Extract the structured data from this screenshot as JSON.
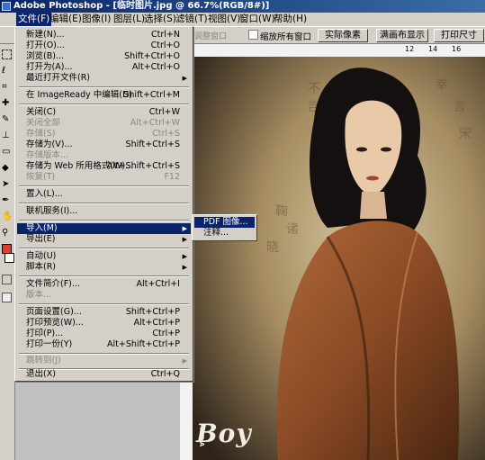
{
  "window": {
    "title": "Adobe Photoshop - [临时图片.jpg @ 66.7%(RGB/8#)]"
  },
  "menubar": {
    "items": [
      "文件(F)",
      "编辑(E)",
      "图像(I)",
      "图层(L)",
      "选择(S)",
      "滤镜(T)",
      "视图(V)",
      "窗口(W)",
      "帮助(H)"
    ]
  },
  "options": {
    "faded_label": "调整窗口",
    "checkbox_label": "缩放所有窗口",
    "actual_pixels": "实际像素",
    "fit_screen": "满画布显示",
    "print_size": "打印尺寸",
    "ruler_top_ticks": [
      "12",
      "14",
      "16"
    ]
  },
  "file_menu": {
    "items": [
      {
        "label": "新建(N)...",
        "shortcut": "Ctrl+N"
      },
      {
        "label": "打开(O)...",
        "shortcut": "Ctrl+O"
      },
      {
        "label": "浏览(B)...",
        "shortcut": "Shift+Ctrl+O"
      },
      {
        "label": "打开为(A)...",
        "shortcut": "Alt+Ctrl+O"
      },
      {
        "label": "最近打开文件(R)",
        "shortcut": "",
        "submenu": true
      },
      {
        "label": "在 ImageReady 中编辑(D)",
        "shortcut": "Shift+Ctrl+M"
      },
      {
        "label": "关闭(C)",
        "shortcut": "Ctrl+W"
      },
      {
        "label": "关闭全部",
        "shortcut": "Alt+Ctrl+W",
        "disabled": true
      },
      {
        "label": "存储(S)",
        "shortcut": "Ctrl+S",
        "disabled": true
      },
      {
        "label": "存储为(V)...",
        "shortcut": "Shift+Ctrl+S"
      },
      {
        "label": "存储版本...",
        "shortcut": "",
        "disabled": true
      },
      {
        "label": "存储为 Web 所用格式(W)...",
        "shortcut": "Alt+Shift+Ctrl+S"
      },
      {
        "label": "恢复(T)",
        "shortcut": "F12",
        "disabled": true
      },
      {
        "label": "置入(L)...",
        "shortcut": ""
      },
      {
        "label": "联机服务(I)...",
        "shortcut": ""
      },
      {
        "label": "导入(M)",
        "shortcut": "",
        "submenu": true,
        "highlighted": true
      },
      {
        "label": "导出(E)",
        "shortcut": "",
        "submenu": true
      },
      {
        "label": "自动(U)",
        "shortcut": "",
        "submenu": true
      },
      {
        "label": "脚本(R)",
        "shortcut": "",
        "submenu": true
      },
      {
        "label": "文件简介(F)...",
        "shortcut": "Alt+Ctrl+I"
      },
      {
        "label": "版本...",
        "shortcut": "",
        "disabled": true
      },
      {
        "label": "页面设置(G)...",
        "shortcut": "Shift+Ctrl+P"
      },
      {
        "label": "打印预览(W)...",
        "shortcut": "Alt+Ctrl+P"
      },
      {
        "label": "打印(P)...",
        "shortcut": "Ctrl+P"
      },
      {
        "label": "打印一份(Y)",
        "shortcut": "Alt+Shift+Ctrl+P"
      },
      {
        "label": "跳转到(J)",
        "shortcut": "",
        "submenu": true,
        "disabled": true
      },
      {
        "label": "退出(X)",
        "shortcut": "Ctrl+Q"
      }
    ]
  },
  "import_submenu": {
    "items": [
      {
        "label": "PDF 图像...",
        "highlighted": true
      },
      {
        "label": "注释..."
      }
    ]
  },
  "photo": {
    "watermark": "Boy",
    "watermark_small": "NAVA"
  },
  "colors": {
    "highlight": "#0a246a",
    "title_gradient_end": "#3a6ea5",
    "menu_bg": "#d4d0c8",
    "disabled_text": "#8a8780"
  }
}
